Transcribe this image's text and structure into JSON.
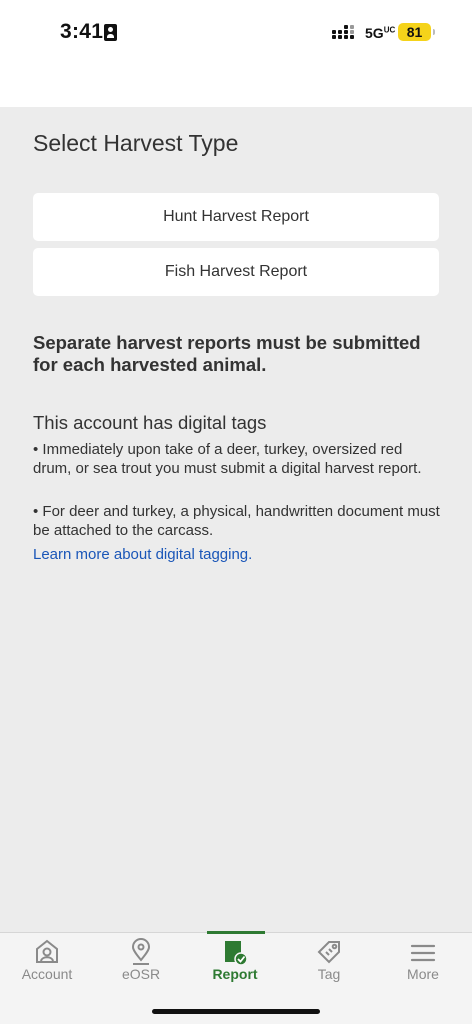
{
  "status_bar": {
    "time": "3:41",
    "network": "5G",
    "network_suffix": "UC",
    "battery": "81"
  },
  "page": {
    "title": "Select Harvest Type",
    "buttons": [
      {
        "label": "Hunt Harvest Report"
      },
      {
        "label": "Fish Harvest Report"
      }
    ],
    "notice": "Separate harvest reports must be submitted for each harvested animal.",
    "tags_heading": "This account has digital tags",
    "bullets": [
      "• Immediately upon take of a deer, turkey, oversized red drum, or sea trout you must submit a digital harvest report.",
      "• For deer and turkey, a physical, handwritten document must be attached to the carcass."
    ],
    "learn_more": "Learn more about digital tagging."
  },
  "tabbar": {
    "active": "Report",
    "accent_color": "#2e7a32",
    "tabs": [
      {
        "label": "Account",
        "icon": "account-icon"
      },
      {
        "label": "eOSR",
        "icon": "location-pin-icon"
      },
      {
        "label": "Report",
        "icon": "report-check-icon"
      },
      {
        "label": "Tag",
        "icon": "tag-icon"
      },
      {
        "label": "More",
        "icon": "menu-icon"
      }
    ]
  }
}
